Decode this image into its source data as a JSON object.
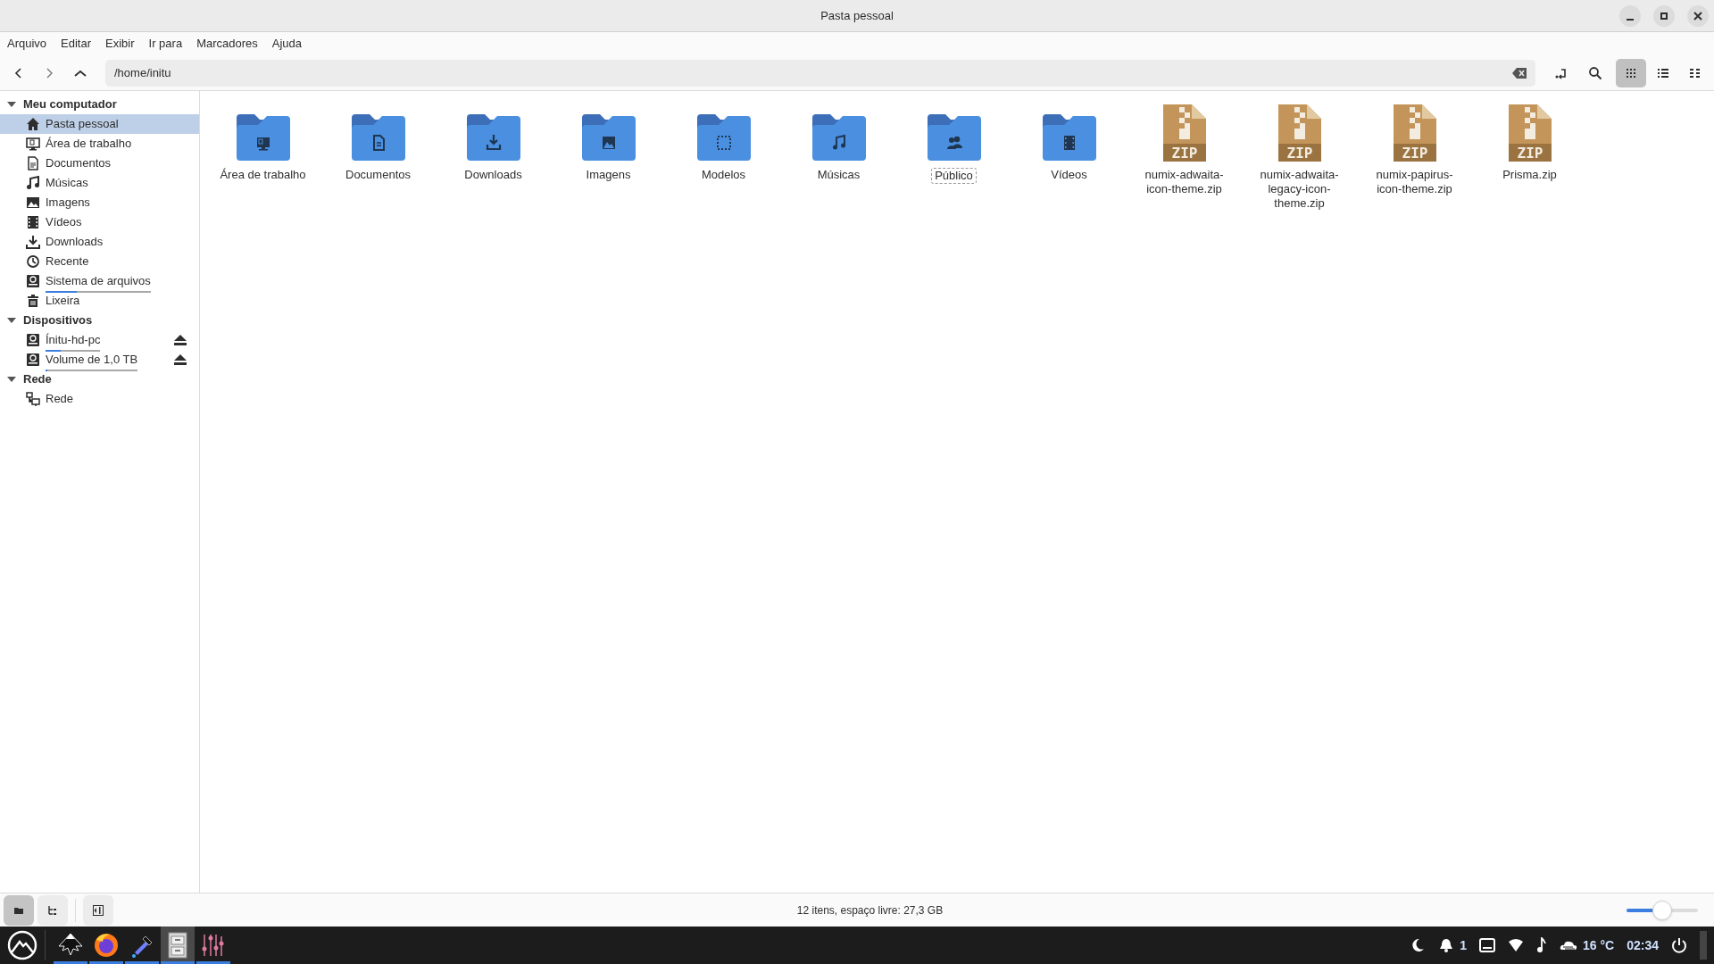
{
  "window": {
    "title": "Pasta pessoal"
  },
  "menu": [
    "Arquivo",
    "Editar",
    "Exibir",
    "Ir para",
    "Marcadores",
    "Ajuda"
  ],
  "toolbar": {
    "path": "/home/initu",
    "view_modes": [
      {
        "kind": "icons",
        "selected": true
      },
      {
        "kind": "list",
        "selected": false
      },
      {
        "kind": "compact",
        "selected": false
      }
    ]
  },
  "sidebar": [
    {
      "title": "Meu computador",
      "expanded": true,
      "items": [
        {
          "label": "Pasta pessoal",
          "kind": "home",
          "selected": true
        },
        {
          "label": "Área de trabalho",
          "kind": "desktop",
          "selected": false
        },
        {
          "label": "Documentos",
          "kind": "document",
          "selected": false
        },
        {
          "label": "Músicas",
          "kind": "music",
          "selected": false
        },
        {
          "label": "Imagens",
          "kind": "image",
          "selected": false
        },
        {
          "label": "Vídeos",
          "kind": "video",
          "selected": false
        },
        {
          "label": "Downloads",
          "kind": "download",
          "selected": false
        },
        {
          "label": "Recente",
          "kind": "recent",
          "selected": false
        },
        {
          "label": "Sistema de arquivos",
          "kind": "drive",
          "selected": false,
          "level": 0.3
        },
        {
          "label": "Lixeira",
          "kind": "trash",
          "selected": false
        }
      ]
    },
    {
      "title": "Dispositivos",
      "expanded": true,
      "items": [
        {
          "label": "Ínitu-hd-pc",
          "kind": "drive",
          "selected": false,
          "level": 0.27,
          "ejectable": true
        },
        {
          "label": "Volume de 1,0 TB",
          "kind": "drive",
          "selected": false,
          "level": 0.02,
          "ejectable": true
        }
      ]
    },
    {
      "title": "Rede",
      "expanded": true,
      "items": [
        {
          "label": "Rede",
          "kind": "network",
          "selected": false
        }
      ]
    }
  ],
  "files": [
    {
      "name": "Área de trabalho",
      "kind": "desktop",
      "focused": false
    },
    {
      "name": "Documentos",
      "kind": "document",
      "focused": false
    },
    {
      "name": "Downloads",
      "kind": "download",
      "focused": false
    },
    {
      "name": "Imagens",
      "kind": "image",
      "focused": false
    },
    {
      "name": "Modelos",
      "kind": "template",
      "focused": false
    },
    {
      "name": "Músicas",
      "kind": "music",
      "focused": false
    },
    {
      "name": "Público",
      "kind": "people",
      "focused": true
    },
    {
      "name": "Vídeos",
      "kind": "video",
      "focused": false
    },
    {
      "name": "numix-adwaita-icon-theme.zip",
      "kind": "zip",
      "badge": "ZIP",
      "focused": false
    },
    {
      "name": "numix-adwaita-legacy-icon-theme.zip",
      "kind": "zip",
      "badge": "ZIP",
      "focused": false
    },
    {
      "name": "numix-papirus-icon-theme.zip",
      "kind": "zip",
      "badge": "ZIP",
      "focused": false
    },
    {
      "name": "Prisma.zip",
      "kind": "zip",
      "badge": "ZIP",
      "focused": false
    }
  ],
  "status_bar": {
    "pane_modes": [
      {
        "kind": "places",
        "selected": true
      },
      {
        "kind": "tree",
        "selected": false
      }
    ],
    "text": "12 itens, espaço livre: 27,3 GB",
    "zoom": {
      "level": 0.5
    }
  },
  "taskbar": {
    "apps": [
      {
        "kind": "vector",
        "running": true,
        "active": false
      },
      {
        "kind": "browser",
        "running": true,
        "active": false
      },
      {
        "kind": "picker",
        "running": true,
        "active": false
      },
      {
        "kind": "files",
        "running": true,
        "active": true
      },
      {
        "kind": "mixer",
        "running": true,
        "active": false
      }
    ],
    "notifications": "1",
    "temperature": "16 °C",
    "clock": "02:34"
  }
}
